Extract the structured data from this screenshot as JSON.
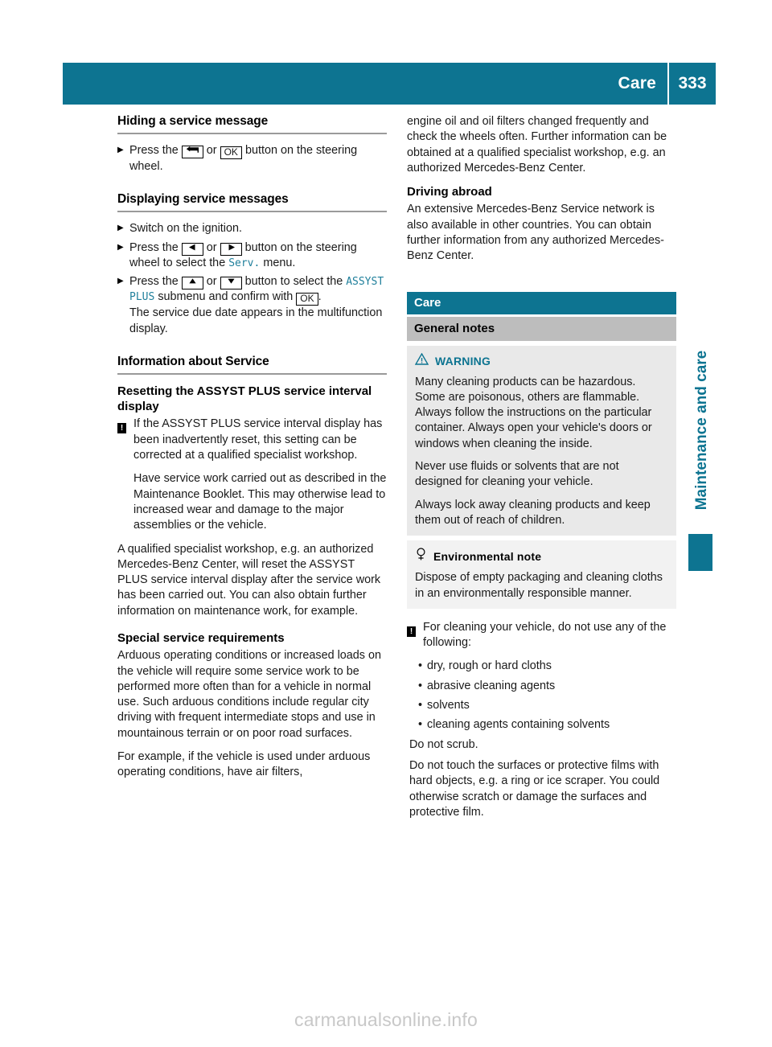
{
  "header": {
    "title": "Care",
    "page_number": "333"
  },
  "side_tab": {
    "label": "Maintenance and care"
  },
  "watermark": "carmanualsonline.info",
  "colors": {
    "teal": "#0d7491",
    "display_text": "#1f7f9b",
    "gray_caption": "#bdbdbd",
    "box_gray": "#e9e9e9",
    "env_box_gray": "#f2f2f2"
  },
  "left_column": {
    "section_hide": {
      "heading": "Hiding a service message",
      "step_1_pre": "Press the",
      "step_1_key_a": "back-arrow",
      "step_1_or": "or",
      "step_1_key_b": "OK",
      "step_1_post": "button on the steering wheel."
    },
    "section_display": {
      "heading": "Displaying service messages",
      "step_1": "Switch on the ignition.",
      "step_2_pre": "Press the",
      "step_2_or": "or",
      "step_2_mid": "button on the steering wheel to select the",
      "step_2_display": "Serv.",
      "step_2_post": "menu.",
      "step_3_pre": "Press the",
      "step_3_or": "or",
      "step_3_mid": "button to select the",
      "step_3_display": "ASSYST PLUS",
      "step_3_mid2": "submenu and confirm with",
      "step_3_key": "OK",
      "step_3_period": ".",
      "step_3_result": "The service due date appears in the multifunction display."
    },
    "section_info": {
      "heading": "Information about Service",
      "sub_heading_1": "Resetting the ASSYST PLUS service interval display",
      "note_1": "If the ASSYST PLUS service interval display has been inadvertently reset, this setting can be corrected at a qualified specialist workshop.",
      "note_1_cont": "Have service work carried out as described in the Maintenance Booklet. This may otherwise lead to increased wear and damage to the major assemblies or the vehicle.",
      "para_1": "A qualified specialist workshop, e.g. an authorized Mercedes-Benz Center, will reset the ASSYST PLUS service interval display after the service work has been carried out. You can also obtain further information on maintenance work, for example.",
      "sub_heading_2": "Special service requirements",
      "para_2": "Arduous operating conditions or increased loads on the vehicle will require some service work to be performed more often than for a vehicle in normal use. Such arduous conditions include regular city driving with frequent intermediate stops and use in mountainous terrain or on poor road surfaces.",
      "para_3": "For example, if the vehicle is used under arduous operating conditions, have air filters,"
    }
  },
  "right_column": {
    "continuation": "engine oil and oil filters changed frequently and check the wheels often. Further information can be obtained at a qualified specialist workshop, e.g. an authorized Mercedes-Benz Center.",
    "driving_abroad": {
      "heading": "Driving abroad",
      "para": "An extensive Mercedes-Benz Service network is also available in other countries. You can obtain further information from any authorized Mercedes-Benz Center."
    },
    "care_caption": "Care",
    "general_notes_caption": "General notes",
    "warning_box": {
      "label": "WARNING",
      "icon": "warning-triangle",
      "para_1": "Many cleaning products can be hazardous. Some are poisonous, others are flammable. Always follow the instructions on the particular container. Always open your vehicle's doors or windows when cleaning the inside.",
      "para_2": "Never use fluids or solvents that are not designed for cleaning your vehicle.",
      "para_3": "Always lock away cleaning products and keep them out of reach of children."
    },
    "environmental_box": {
      "label": "Environmental note",
      "icon": "environment-tree",
      "para_1": "Dispose of empty packaging and cleaning cloths in an environmentally responsible manner."
    },
    "cleaning_note": {
      "intro": "For cleaning your vehicle, do not use any of the following:",
      "bullet_mark": "•",
      "items": [
        "dry, rough or hard cloths",
        "abrasive cleaning agents",
        "solvents",
        "cleaning agents containing solvents"
      ],
      "after_1": "Do not scrub.",
      "after_2": "Do not touch the surfaces or protective films with hard objects, e.g. a ring or ice scraper. You could otherwise scratch or damage the surfaces and protective film."
    }
  },
  "glyphs": {
    "step_arrow": "▶",
    "key_ok": "OK",
    "key_left": "◀",
    "key_right": "▶",
    "key_up": "▲",
    "key_down": "▼",
    "exclam": "!"
  }
}
